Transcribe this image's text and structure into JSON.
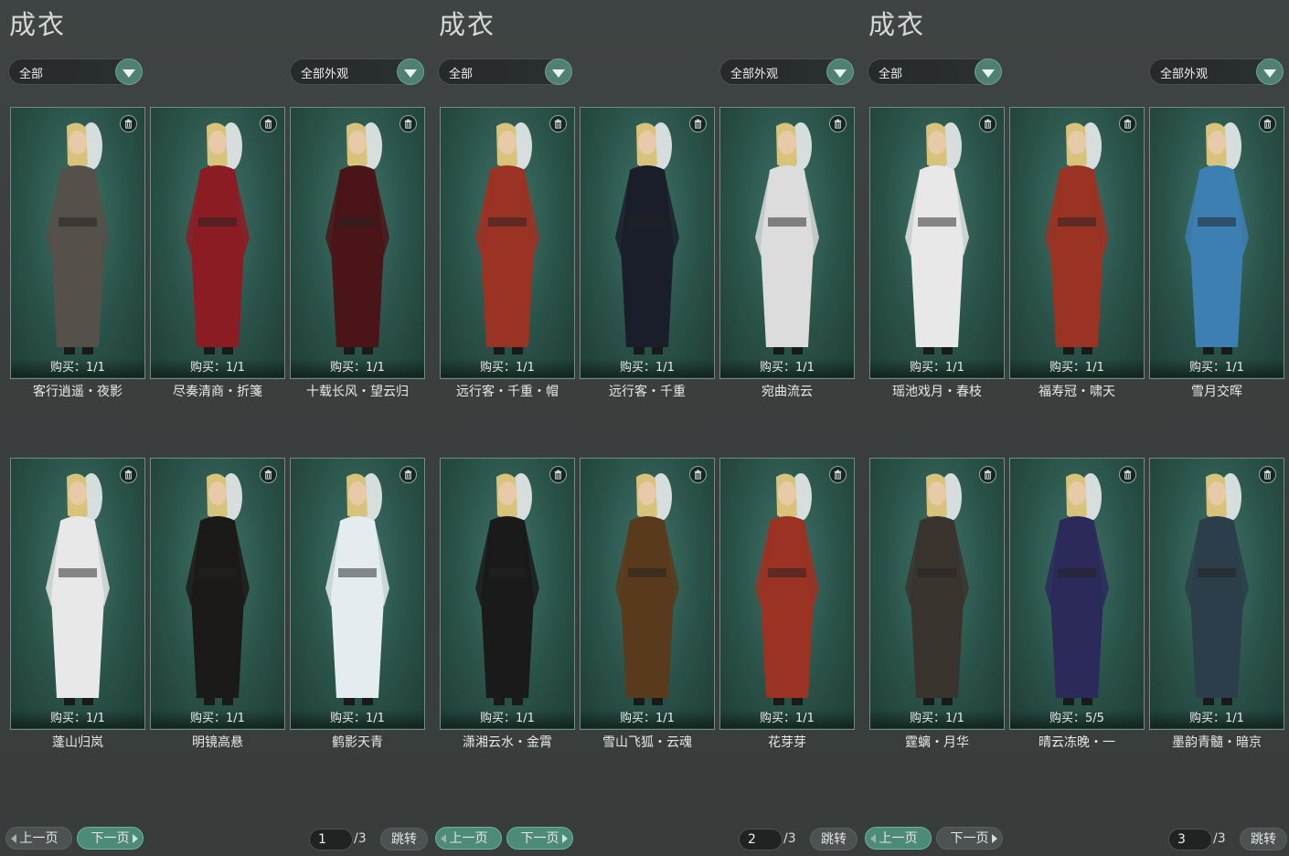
{
  "colors": {
    "background": "#3a3f3e",
    "card_bg": "#2a5249",
    "accent": "#4f8072",
    "active_button": "#4c8a79"
  },
  "panels": [
    {
      "title": "成衣",
      "filter_left": "全部",
      "filter_right": "全部外观",
      "items": [
        {
          "name": "客行逍遥・夜影",
          "buy": "购买：1/1"
        },
        {
          "name": "尽奏清商・折箋",
          "buy": "购买：1/1"
        },
        {
          "name": "十载长风・望云归",
          "buy": "购买：1/1"
        },
        {
          "name": "蓬山归岚",
          "buy": "购买：1/1"
        },
        {
          "name": "明镜高悬",
          "buy": "购买：1/1"
        },
        {
          "name": "鹤影天青",
          "buy": "购买：1/1"
        }
      ],
      "pager": {
        "prev": "上一页",
        "next": "下一页",
        "current": "1",
        "total": "/3",
        "jump": "跳转",
        "active": "next"
      }
    },
    {
      "title": "成衣",
      "filter_left": "全部",
      "filter_right": "全部外观",
      "items": [
        {
          "name": "远行客・千重・帽",
          "buy": "购买：1/1"
        },
        {
          "name": "远行客・千重",
          "buy": "购买：1/1"
        },
        {
          "name": "宛曲流云",
          "buy": "购买：1/1"
        },
        {
          "name": "潇湘云水・金霄",
          "buy": "购买：1/1"
        },
        {
          "name": "雪山飞狐・云魂",
          "buy": "购买：1/1"
        },
        {
          "name": "花芽芽",
          "buy": "购买：1/1"
        }
      ],
      "pager": {
        "prev": "上一页",
        "next": "下一页",
        "current": "2",
        "total": "/3",
        "jump": "跳转",
        "active": "both"
      }
    },
    {
      "title": "成衣",
      "filter_left": "全部",
      "filter_right": "全部外观",
      "items": [
        {
          "name": "瑶池戏月・春枝",
          "buy": "购买：1/1"
        },
        {
          "name": "福寿冠・啸天",
          "buy": "购买：1/1"
        },
        {
          "name": "雪月交晖",
          "buy": "购买：1/1"
        },
        {
          "name": "霆螭・月华",
          "buy": "购买：1/1"
        },
        {
          "name": "晴云冻晚・一",
          "buy": "购买：5/5"
        },
        {
          "name": "墨韵青髓・暗京",
          "buy": "购买：1/1"
        }
      ],
      "pager": {
        "prev": "上一页",
        "next": "下一页",
        "current": "3",
        "total": "/3",
        "jump": "跳转",
        "active": "prev"
      }
    }
  ],
  "outfit_colors": [
    [
      "#55504a",
      "#8b1c24",
      "#4a1418",
      "#e8e8e8",
      "#1c1a18",
      "#e4ecef"
    ],
    [
      "#9a3324",
      "#1a1e2a",
      "#dcdcdc",
      "#1a1a1a",
      "#5a3a1c",
      "#9a3324"
    ],
    [
      "#e8e8e8",
      "#9a3324",
      "#3d7fb3",
      "#3a342e",
      "#2c2a5a",
      "#2c3e4a"
    ]
  ]
}
